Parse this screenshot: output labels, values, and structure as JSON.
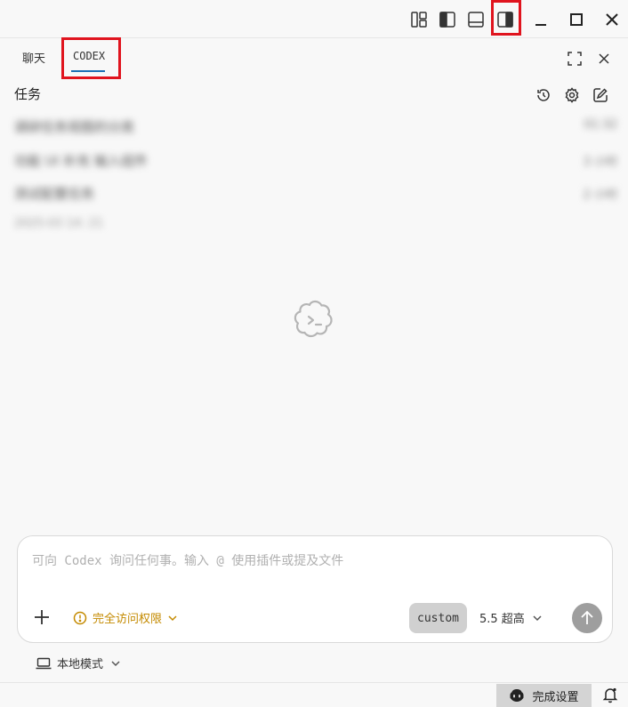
{
  "titlebar": {
    "icons": [
      "layout-customize-icon",
      "toggle-primary-sidebar-icon",
      "toggle-panel-icon",
      "toggle-secondary-sidebar-icon",
      "minimize-icon",
      "maximize-icon",
      "close-icon"
    ]
  },
  "tabs": [
    {
      "label": "聊天",
      "active": false
    },
    {
      "label": "CODEX",
      "active": true
    }
  ],
  "tasks_header": {
    "title": "任务"
  },
  "tasks": [
    {
      "title": "调研任务视图的分类",
      "time": "01:32"
    },
    {
      "title": "功能 UI 补充 输入组件",
      "time": "3 小时"
    },
    {
      "title": "测试配置任务",
      "time": "2 小时"
    },
    {
      "title": "2025-03  14:  21",
      "time": ""
    }
  ],
  "composer": {
    "placeholder": "可向 Codex 询问任何事。输入 @ 使用插件或提及文件",
    "value": "",
    "permission_label": "完全访问权限",
    "custom_label": "custom",
    "model_label": "5.5 超高"
  },
  "mode": {
    "label": "本地模式"
  },
  "statusbar": {
    "setup_label": "完成设置"
  },
  "colors": {
    "accent_underline": "#1a6fb5",
    "highlight_red": "#e0141e",
    "permission_warning": "#c48a00"
  }
}
